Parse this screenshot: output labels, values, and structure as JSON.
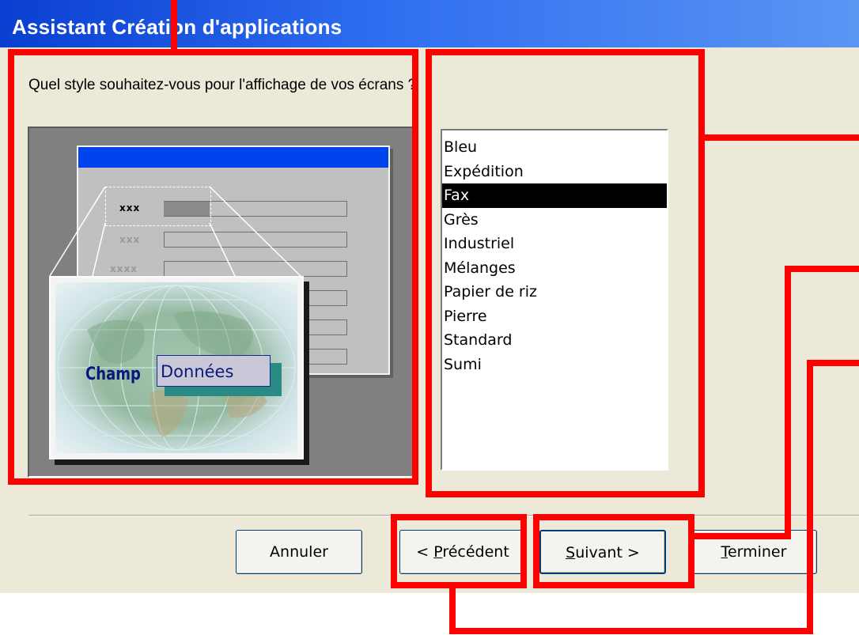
{
  "window": {
    "title": "Assistant Création d'applications"
  },
  "prompt": "Quel style souhaitez-vous pour l'affichage de vos écrans ?",
  "preview": {
    "labels": [
      "xxx",
      "xxx",
      "xxxx"
    ],
    "field_label": "Champ",
    "field_value": "Données"
  },
  "styles": {
    "items": [
      "Bleu",
      "Expédition",
      "Fax",
      "Grès",
      "Industriel",
      "Mélanges",
      "Papier de riz",
      "Pierre",
      "Standard",
      "Sumi"
    ],
    "selected": "Fax"
  },
  "buttons": {
    "cancel": "Annuler",
    "previous": {
      "prefix": "< ",
      "mnemonic": "P",
      "rest": "récédent"
    },
    "next": {
      "mnemonic": "S",
      "rest": "uivant >"
    },
    "finish": {
      "mnemonic": "T",
      "rest": "erminer"
    }
  },
  "colors": {
    "titlebar": "#0a3fd1",
    "dialog_bg": "#ece9d8",
    "annotation": "#ff0000",
    "selection": "#000000"
  }
}
